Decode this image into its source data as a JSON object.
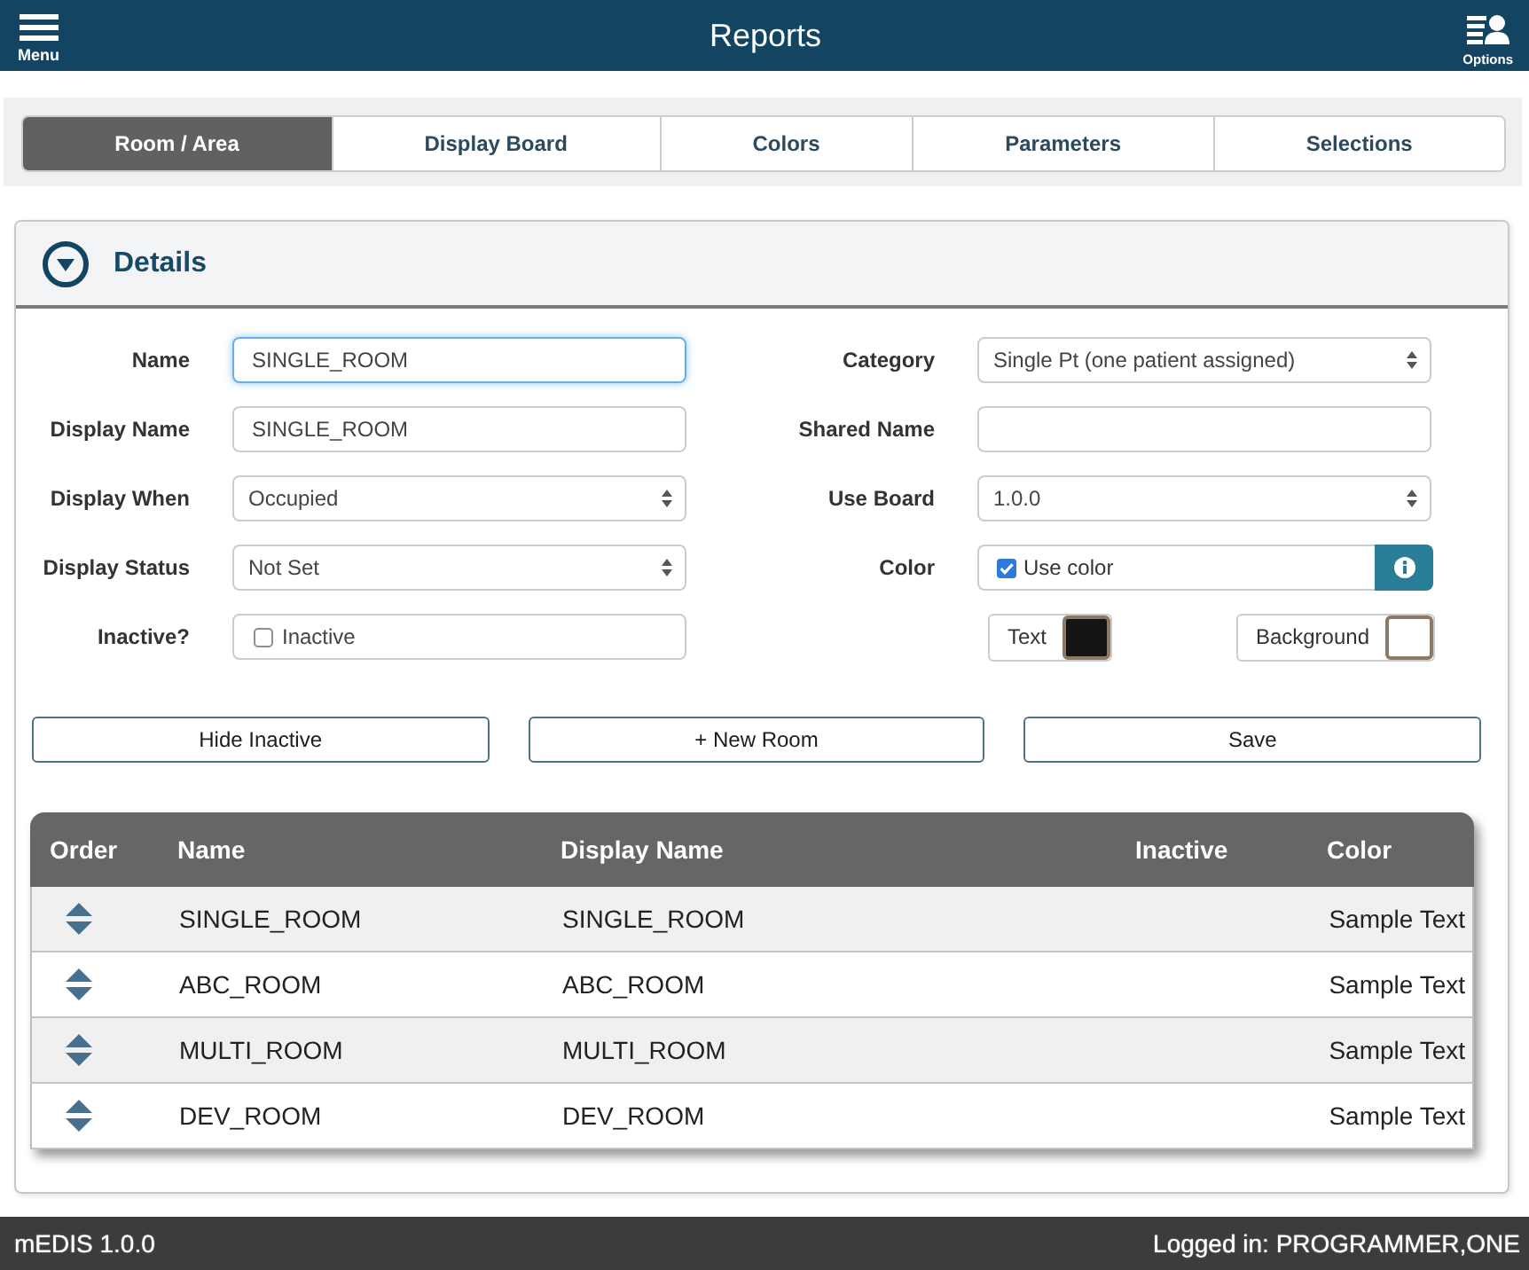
{
  "header": {
    "menu_label": "Menu",
    "title": "Reports",
    "options_label": "Options"
  },
  "tabs": [
    {
      "label": "Room / Area",
      "selected": true
    },
    {
      "label": "Display Board",
      "selected": false
    },
    {
      "label": "Colors",
      "selected": false
    },
    {
      "label": "Parameters",
      "selected": false
    },
    {
      "label": "Selections",
      "selected": false
    }
  ],
  "details": {
    "title": "Details"
  },
  "form": {
    "left": [
      {
        "kind": "text",
        "label": "Name",
        "value": "SINGLE_ROOM",
        "focused": true
      },
      {
        "kind": "text",
        "label": "Display Name",
        "value": "SINGLE_ROOM",
        "focused": false
      },
      {
        "kind": "select",
        "label": "Display When",
        "value": "Occupied",
        "focused": false
      },
      {
        "kind": "select",
        "label": "Display Status",
        "value": "Not Set",
        "focused": false
      },
      {
        "kind": "checkbox",
        "label": "Inactive?",
        "option": "Inactive",
        "checked": false,
        "focused": false
      }
    ],
    "right": [
      {
        "kind": "select",
        "label": "Category",
        "value": "Single Pt (one patient assigned)",
        "focused": false
      },
      {
        "kind": "text",
        "label": "Shared Name",
        "focused": false
      },
      {
        "kind": "select",
        "label": "Use Board",
        "value": "1.0.0",
        "focused": false
      },
      {
        "kind": "color",
        "label": "Color",
        "option": "Use color",
        "checked": true,
        "focused": false
      }
    ],
    "color_swatches": [
      {
        "label": "Text",
        "color": "#141414"
      },
      {
        "label": "Background",
        "color": "#ffffff"
      }
    ]
  },
  "buttons": [
    "Hide Inactive",
    "+ New Room",
    "Save"
  ],
  "table": {
    "columns": [
      "Order",
      "Name",
      "Display Name",
      "Inactive",
      "Color"
    ],
    "rows": [
      {
        "name": "SINGLE_ROOM",
        "display_name": "SINGLE_ROOM",
        "color_sample": "Sample Text"
      },
      {
        "name": "ABC_ROOM",
        "display_name": "ABC_ROOM",
        "color_sample": "Sample Text"
      },
      {
        "name": "MULTI_ROOM",
        "display_name": "MULTI_ROOM",
        "color_sample": "Sample Text"
      },
      {
        "name": "DEV_ROOM",
        "display_name": "DEV_ROOM",
        "color_sample": "Sample Text"
      }
    ]
  },
  "footer": {
    "app": "mEDIS 1.0.0",
    "user": "Logged in: PROGRAMMER,ONE"
  }
}
